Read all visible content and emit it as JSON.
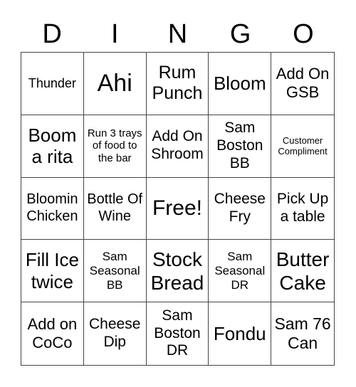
{
  "header": {
    "letters": [
      "D",
      "I",
      "N",
      "G",
      "O"
    ]
  },
  "cells": [
    "Thunder",
    "Ahi",
    "Rum Punch",
    "Bloom",
    "Add On GSB",
    "Boom a rita",
    "Run 3 trays of food to the bar",
    "Add On Shroom",
    "Sam Boston BB",
    "Customer Compliment",
    "Bloomin Chicken",
    "Bottle Of Wine",
    "Free!",
    "Cheese Fry",
    "Pick Up a table",
    "Fill Ice twice",
    "Sam Seasonal BB",
    "Stock Bread",
    "Sam Seasonal DR",
    "Butter Cake",
    "Add on CoCo",
    "Cheese Dip",
    "Sam Boston DR",
    "Fondu",
    "Sam 76 Can"
  ]
}
